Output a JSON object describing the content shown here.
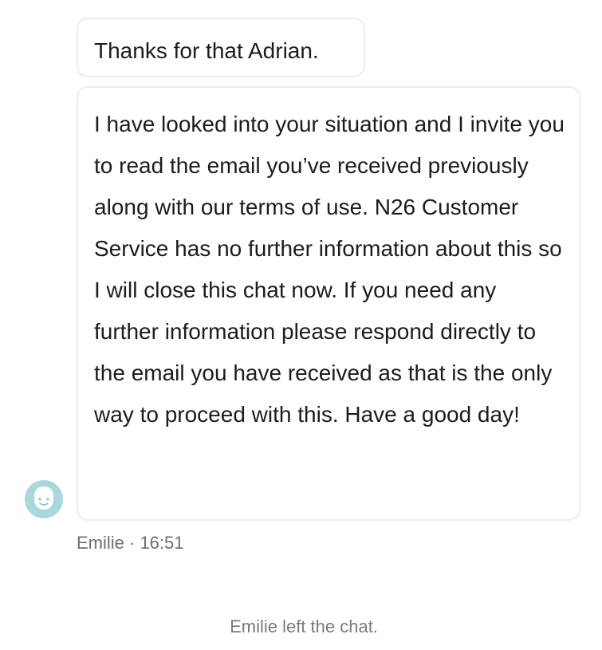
{
  "chat": {
    "messages": [
      {
        "text": "Thanks for that Adrian."
      },
      {
        "text": "I have looked into your situation and I invite you to read the email you’ve received previously along with our terms of use. N26 Customer Service has no further information about this so I will close this chat now. If you need any further information please respond directly to the email you have received as that is the only way to proceed with this. Have a good day!"
      }
    ],
    "agent": {
      "name": "Emilie",
      "time": "16:51",
      "meta_line": "Emilie · 16:51",
      "avatar_icon": "smiley-face-icon",
      "avatar_color": "#a8d8dc"
    },
    "system_note": "Emilie left the chat."
  }
}
